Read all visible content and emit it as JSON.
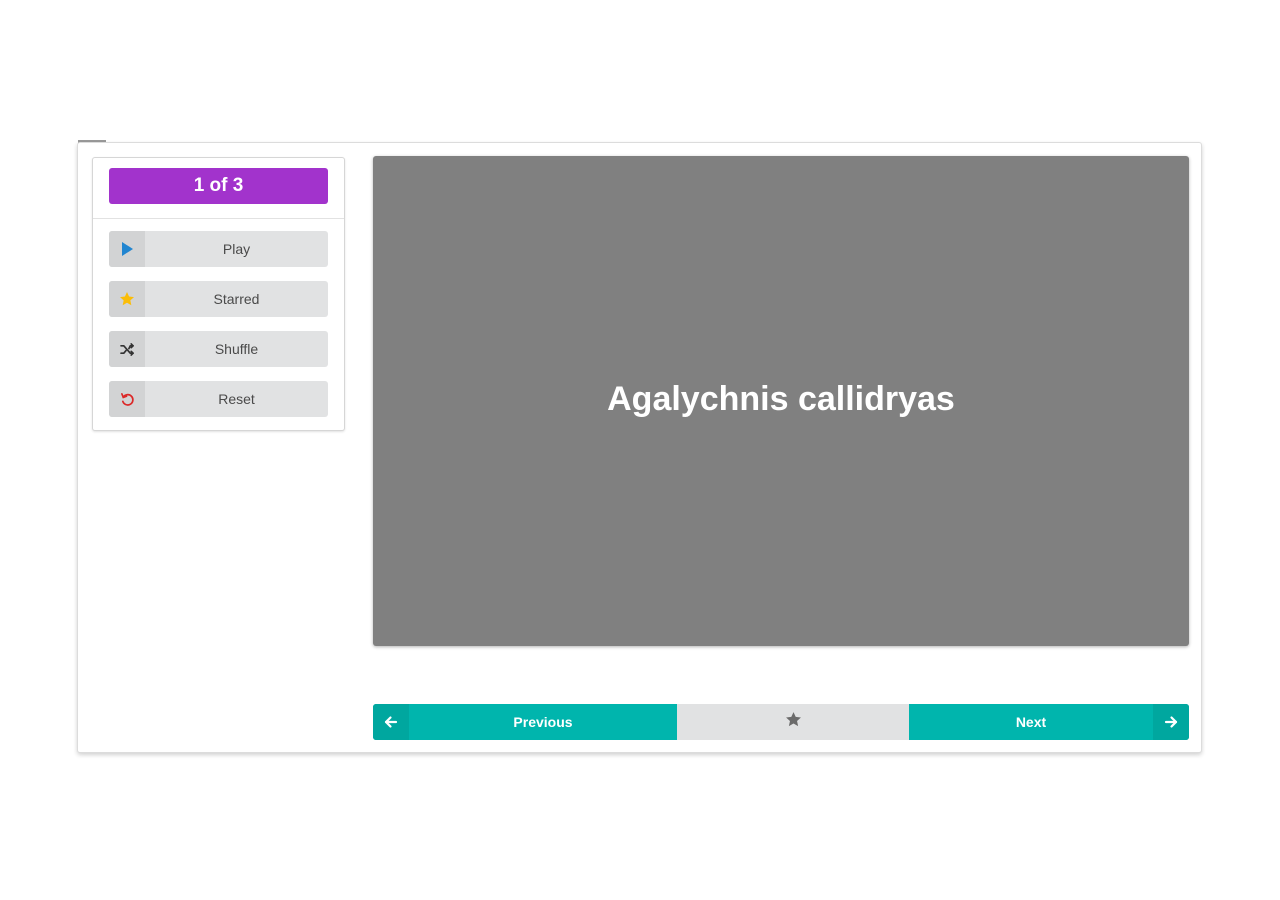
{
  "counter": {
    "text": "1 of 3",
    "color": "#a233cc"
  },
  "sidebar": {
    "buttons": [
      {
        "label": "Play",
        "icon": "play-icon",
        "icon_color": "#2185d0"
      },
      {
        "label": "Starred",
        "icon": "star-icon",
        "icon_color": "#fbbd08"
      },
      {
        "label": "Shuffle",
        "icon": "shuffle-icon",
        "icon_color": "#333333"
      },
      {
        "label": "Reset",
        "icon": "undo-icon",
        "icon_color": "#db2828"
      }
    ]
  },
  "card": {
    "term": "Agalychnis callidryas",
    "background": "#808080"
  },
  "nav": {
    "previous_label": "Previous",
    "next_label": "Next",
    "accent": "#00b5ad",
    "star_icon": "star-icon"
  }
}
